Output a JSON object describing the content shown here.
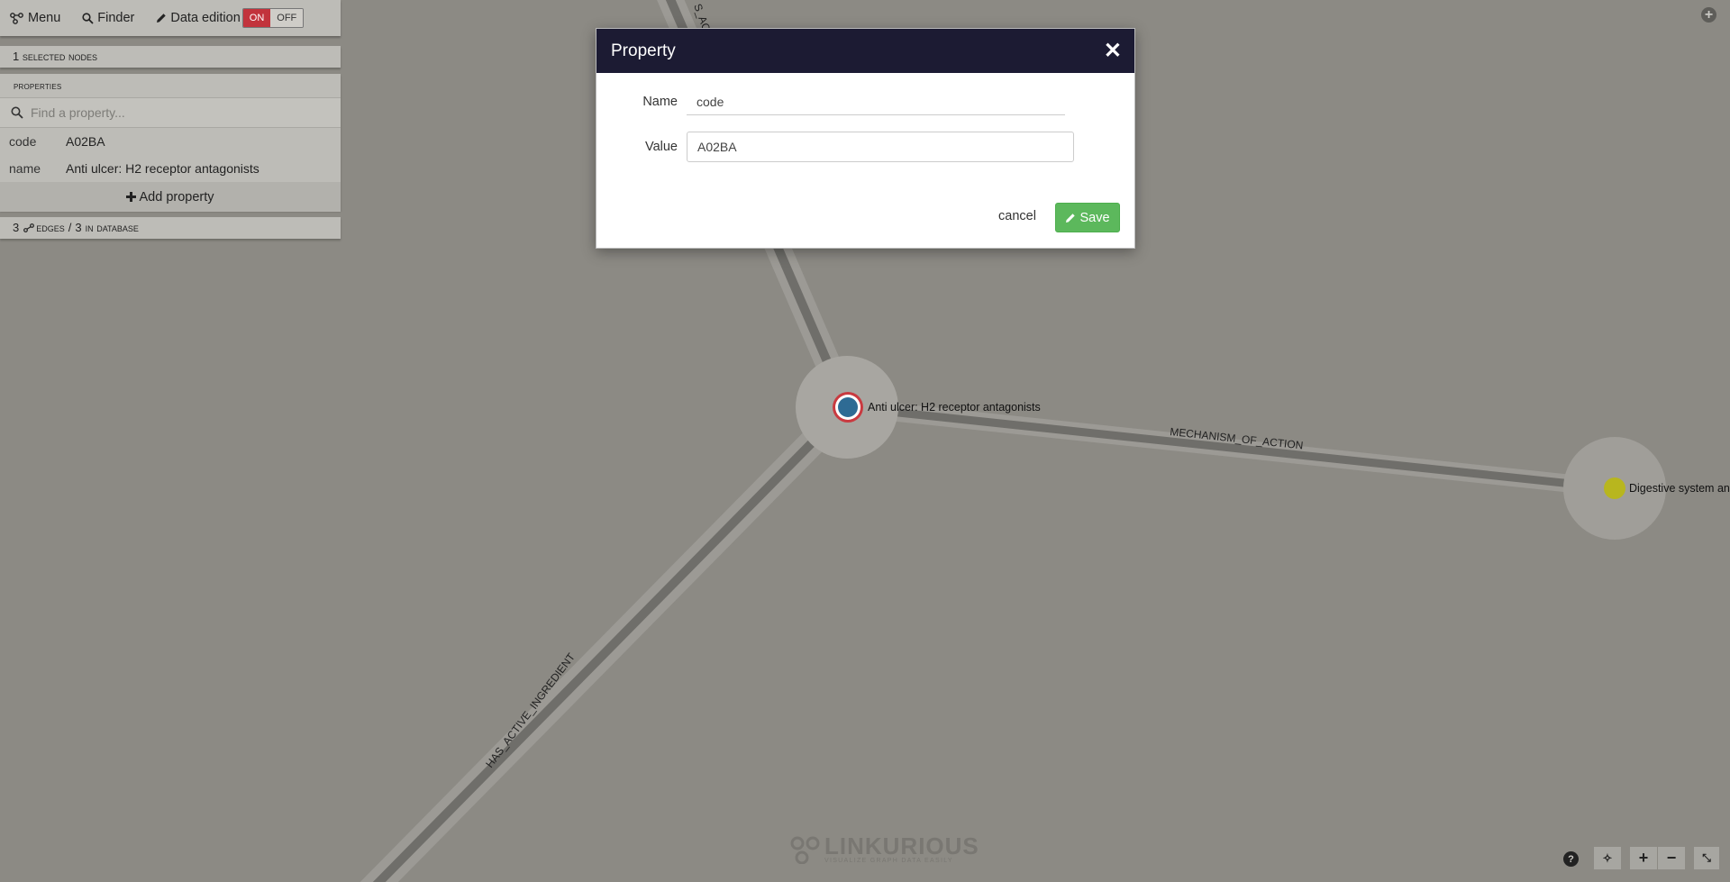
{
  "toolbar": {
    "menu_label": "Menu",
    "finder_label": "Finder",
    "data_edition_label": "Data edition",
    "toggle_on": "ON",
    "toggle_off": "OFF"
  },
  "selection": {
    "count": "1",
    "label": "selected nodes"
  },
  "properties": {
    "header": "properties",
    "search_placeholder": "Find a property...",
    "rows": [
      {
        "key": "code",
        "value": "A02BA"
      },
      {
        "key": "name",
        "value": "Anti ulcer: H2 receptor antagonists"
      }
    ],
    "add_label": "Add property"
  },
  "edges_summary": {
    "count": "3",
    "edges_label": "edges",
    "separator": "/",
    "db_count": "3",
    "db_label": "in database"
  },
  "dialog": {
    "title": "Property",
    "name_label": "Name",
    "name_value": "code",
    "value_label": "Value",
    "value_value": "A02BA",
    "cancel_label": "cancel",
    "save_label": "Save"
  },
  "graph": {
    "nodes": [
      {
        "label": "Anti ulcer: H2 receptor antagonists",
        "color": "#2e6b94",
        "selected": true
      },
      {
        "label": "Digestive system and",
        "color": "#b8b61e",
        "selected": false
      }
    ],
    "edges": [
      {
        "label": "MECHANISM_OF_ACTION"
      },
      {
        "label": "HAS_ACTIVE_INGREDIENT"
      },
      {
        "label": "S_ACTI"
      }
    ]
  },
  "logo": {
    "name": "LINKURIOUS",
    "tagline": "VISUALIZE GRAPH DATA EASILY"
  },
  "colors": {
    "dialog_header": "#1c1b33",
    "save_button": "#5cb85c",
    "toggle_on": "#c2333c",
    "canvas": "#8c8a84"
  }
}
